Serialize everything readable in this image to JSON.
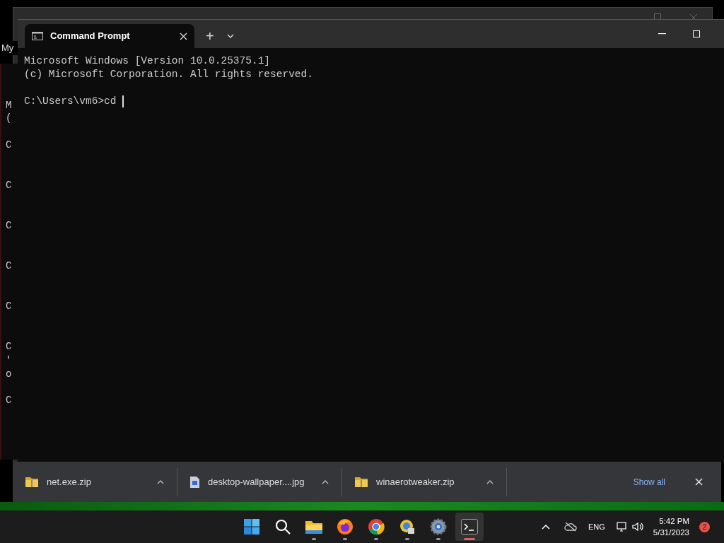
{
  "background_window": {
    "title_fragment": "My",
    "console_fragments": [
      "M",
      "(",
      "C",
      "C",
      "C",
      "C",
      "C",
      "C",
      "'",
      "o",
      "C"
    ]
  },
  "terminal": {
    "tabs": [
      {
        "title": "Command Prompt",
        "selected": true
      }
    ],
    "new_tab": "+",
    "banner": [
      "Microsoft Windows [Version 10.0.25375.1]",
      "(c) Microsoft Corporation. All rights reserved."
    ],
    "prompt": "C:\\Users\\vm6>cd "
  },
  "downloads": {
    "items": [
      {
        "name": "net.exe.zip",
        "kind": "zip"
      },
      {
        "name": "desktop-wallpaper....jpg",
        "kind": "image"
      },
      {
        "name": "winaerotweaker.zip",
        "kind": "zip"
      }
    ],
    "show_all": "Show all"
  },
  "taskbar": {
    "apps": [
      {
        "kind": "start",
        "running": false,
        "selected": false
      },
      {
        "kind": "search",
        "running": false,
        "selected": false
      },
      {
        "kind": "explorer",
        "running": true,
        "selected": false
      },
      {
        "kind": "firefox",
        "running": true,
        "selected": false
      },
      {
        "kind": "chrome",
        "running": true,
        "selected": false
      },
      {
        "kind": "app",
        "running": true,
        "selected": false
      },
      {
        "kind": "settings",
        "running": true,
        "selected": false
      },
      {
        "kind": "terminal",
        "running": true,
        "selected": true
      }
    ],
    "language": "ENG",
    "time": "5:42 PM",
    "date": "5/31/2023",
    "notifications": "2"
  }
}
